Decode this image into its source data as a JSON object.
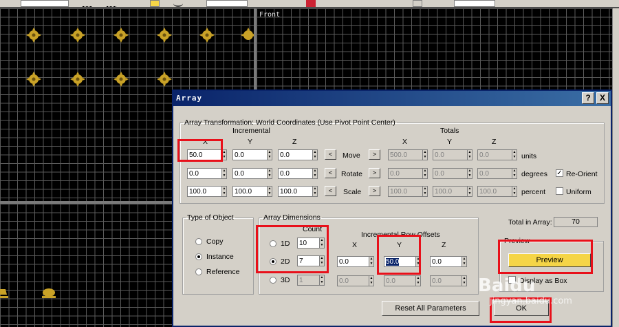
{
  "viewports": {
    "front_label": "Front"
  },
  "dialog": {
    "title": "Array",
    "help_button": "?",
    "close_button": "X"
  },
  "transformation": {
    "legend": "Array Transformation: World Coordinates (Use Pivot Point Center)",
    "incremental_label": "Incremental",
    "totals_label": "Totals",
    "axis_x": "X",
    "axis_y": "Y",
    "axis_z": "Z",
    "rows": [
      {
        "name": "Move",
        "inc": [
          "50.0",
          "0.0",
          "0.0"
        ],
        "tot": [
          "500.0",
          "0.0",
          "0.0"
        ],
        "unit": "units"
      },
      {
        "name": "Rotate",
        "inc": [
          "0.0",
          "0.0",
          "0.0"
        ],
        "tot": [
          "0.0",
          "0.0",
          "0.0"
        ],
        "unit": "degrees"
      },
      {
        "name": "Scale",
        "inc": [
          "100.0",
          "100.0",
          "100.0"
        ],
        "tot": [
          "100.0",
          "100.0",
          "100.0"
        ],
        "unit": "percent"
      }
    ],
    "re_orient_label": "Re-Orient",
    "re_orient_checked": true,
    "uniform_label": "Uniform",
    "uniform_checked": false,
    "left_arrow": "<",
    "right_arrow": ">"
  },
  "type_of_object": {
    "legend": "Type of Object",
    "options": [
      "Copy",
      "Instance",
      "Reference"
    ],
    "selected": "Instance"
  },
  "array_dimensions": {
    "legend": "Array Dimensions",
    "count_label": "Count",
    "incremental_offsets_label": "Incremental Row Offsets",
    "axis_x": "X",
    "axis_y": "Y",
    "axis_z": "Z",
    "dims": [
      {
        "label": "1D",
        "count": "10",
        "offsets": []
      },
      {
        "label": "2D",
        "count": "7",
        "offsets": [
          "0.0",
          "50.0",
          "0.0"
        ]
      },
      {
        "label": "3D",
        "count": "1",
        "offsets": [
          "0.0",
          "0.0",
          "0.0"
        ]
      }
    ],
    "selected": "2D"
  },
  "total_in_array": {
    "label": "Total in Array:",
    "value": "70"
  },
  "preview": {
    "legend": "Preview",
    "button_label": "Preview",
    "display_as_box_label": "Display as Box"
  },
  "reset_button_label": "Reset All Parameters",
  "ok_button_label": "OK",
  "watermark": {
    "brand": "Baidu",
    "sub": "jingyan.baidu.com"
  },
  "colors": {
    "title_bar": "#0a246a",
    "highlight": "#e8101a",
    "preview_active": "#f5d547",
    "object_gold": "#c9a227"
  }
}
